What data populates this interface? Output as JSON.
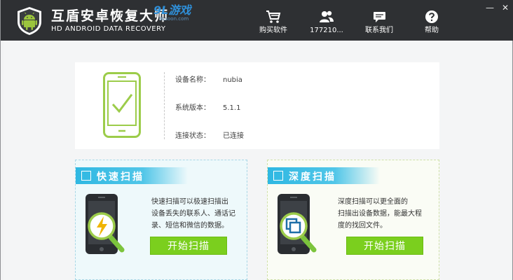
{
  "app": {
    "title": "互盾安卓恢复大师",
    "subtitle": "HD ANDROID DATA RECOVERY",
    "watermark_logo": "9L游戏",
    "watermark_url": "9Lsoon.com"
  },
  "nav": {
    "buy": "购买软件",
    "account": "177210...",
    "contact": "联系我们",
    "help": "帮助"
  },
  "window_controls": {
    "minimize": "—",
    "close": "✕"
  },
  "device": {
    "name_label": "设备名称：",
    "name_value": "nubia",
    "version_label": "系统版本：",
    "version_value": "5.1.1",
    "status_label": "连接状态：",
    "status_value": "已连接"
  },
  "quick_scan": {
    "title": "快速扫描",
    "desc_line1": "快速扫描可以极速扫描出",
    "desc_line2": "设备丢失的联系人、通话记",
    "desc_line3": "录、短信和微信的数据。",
    "button": "开始扫描"
  },
  "deep_scan": {
    "title": "深度扫描",
    "desc_line1": "深度扫描可以更全面的",
    "desc_line2": "扫描出设备数据，能最大程",
    "desc_line3": "度的找回文件。",
    "button": "开始扫描"
  },
  "colors": {
    "titlebar_bg": "#2e3033",
    "accent_blue": "#2fb8e2",
    "accent_green": "#7bcf1e",
    "android_green": "#9bc53d"
  },
  "icons": {
    "logo": "android-shield-icon",
    "buy": "shopping-cart-icon",
    "account": "users-icon",
    "contact": "chat-bubble-icon",
    "help": "question-mark-icon",
    "quick_scan": "lightning-magnifier-icon",
    "deep_scan": "layers-magnifier-icon"
  }
}
